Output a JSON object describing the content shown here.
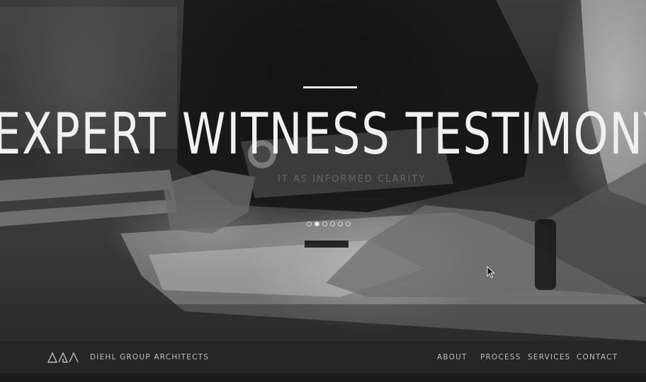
{
  "hero": {
    "headline": "EXPERT WITNESS TESTIMONY",
    "subtitle": "IT AS INFORMED CLARITY",
    "slides": {
      "count": 6,
      "active_index": 1
    }
  },
  "brand": {
    "logo_icon": "dga-triangle-logo",
    "name": "DIEHL GROUP ARCHITECTS"
  },
  "nav": {
    "items": [
      {
        "label": "ABOUT"
      },
      {
        "label": "PROCESS"
      },
      {
        "label": "SERVICES"
      },
      {
        "label": "CONTACT"
      }
    ]
  },
  "colors": {
    "text_light": "#f0f0f0",
    "nav_text": "#bdbdbd",
    "navbar_bg": "#262626"
  }
}
